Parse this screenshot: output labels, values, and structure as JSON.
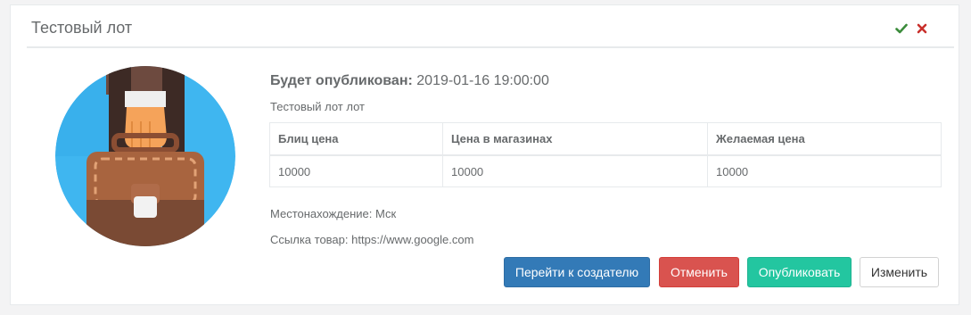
{
  "panel": {
    "title": "Тестовый лот",
    "icons": {
      "approve": "check-icon",
      "close": "close-icon"
    },
    "colors": {
      "approve": "#3c8c3c",
      "close": "#c9302c"
    }
  },
  "lot": {
    "image_icon": "briefcase-illustration",
    "publish_label": "Будет опубликован:",
    "publish_date": "2019-01-16 19:00:00",
    "description": "Тестовый лот лот",
    "table": {
      "headers": [
        "Блиц цена",
        "Цена в магазинах",
        "Желаемая цена"
      ],
      "rows": [
        [
          "10000",
          "10000",
          "10000"
        ]
      ]
    },
    "location_label": "Местонахождение:",
    "location_value": "Мск",
    "link_label": "Ссылка товар:",
    "link_value": "https://www.google.com"
  },
  "actions": {
    "goto_creator": "Перейти к создателю",
    "cancel": "Отменить",
    "publish": "Опубликовать",
    "edit": "Изменить"
  }
}
